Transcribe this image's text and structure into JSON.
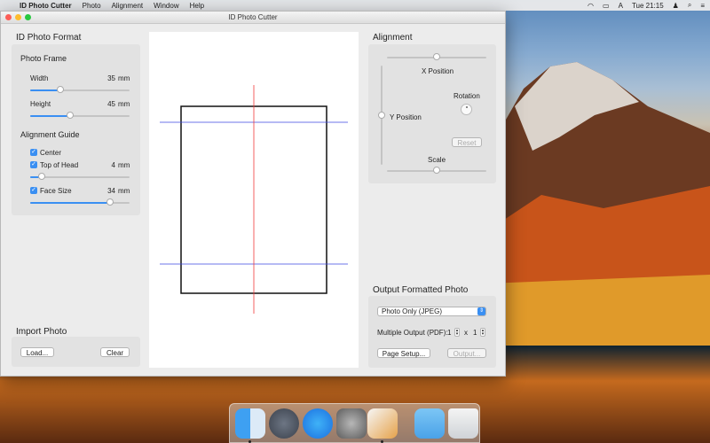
{
  "menubar": {
    "app_name": "ID Photo Cutter",
    "items": [
      "Photo",
      "Alignment",
      "Window",
      "Help"
    ],
    "clock": "Tue 21:15"
  },
  "window": {
    "title": "ID Photo Cutter"
  },
  "format": {
    "title": "ID Photo Format",
    "frame_title": "Photo Frame",
    "width_label": "Width",
    "width_value": "35",
    "height_label": "Height",
    "height_value": "45",
    "unit": "mm",
    "guide_title": "Alignment Guide",
    "center_label": "Center",
    "top_label": "Top of Head",
    "top_value": "4",
    "face_label": "Face Size",
    "face_value": "34"
  },
  "import": {
    "title": "Import Photo",
    "load_label": "Load...",
    "clear_label": "Clear"
  },
  "alignment": {
    "title": "Alignment",
    "x_label": "X Position",
    "y_label": "Y Position",
    "rotation_label": "Rotation",
    "reset_label": "Reset",
    "scale_label": "Scale"
  },
  "output": {
    "title": "Output Formatted Photo",
    "format_value": "Photo Only (JPEG)",
    "multiple_label": "Multiple Output (PDF):",
    "cols": "1",
    "x_sep": "x",
    "rows": "1",
    "page_setup_label": "Page Setup...",
    "output_label": "Output..."
  },
  "colors": {
    "accent": "#3a8ff2",
    "guide_blue": "#3b49e0",
    "guide_red": "#f03a3a"
  },
  "slider_levels": {
    "width": 0.3,
    "height": 0.4,
    "top_of_head": 0.12,
    "face_size": 0.8,
    "x_position": 0.5,
    "y_position": 0.5,
    "scale": 0.5
  },
  "dock": [
    "finder-icon",
    "launchpad-icon",
    "app-store-icon",
    "system-preferences-icon",
    "id-photo-cutter-icon",
    "downloads-folder-icon",
    "trash-icon"
  ]
}
